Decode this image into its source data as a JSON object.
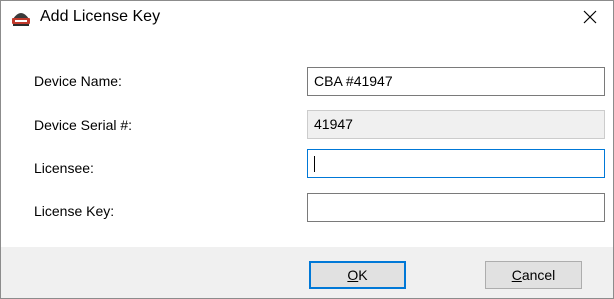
{
  "window": {
    "title": "Add License Key",
    "icon": "app-logo-icon",
    "close_icon": "close-icon"
  },
  "form": {
    "device_name_label": "Device Name:",
    "device_name_value": "CBA #41947",
    "device_serial_label": "Device Serial #:",
    "device_serial_value": "41947",
    "licensee_label": "Licensee:",
    "licensee_value": "",
    "license_key_label": "License Key:",
    "license_key_value": ""
  },
  "buttons": {
    "ok_mnemonic": "O",
    "ok_rest": "K",
    "cancel_mnemonic": "C",
    "cancel_rest": "ancel"
  },
  "colors": {
    "focus_accent": "#0078d7",
    "readonly_bg": "#f0f0f0"
  }
}
